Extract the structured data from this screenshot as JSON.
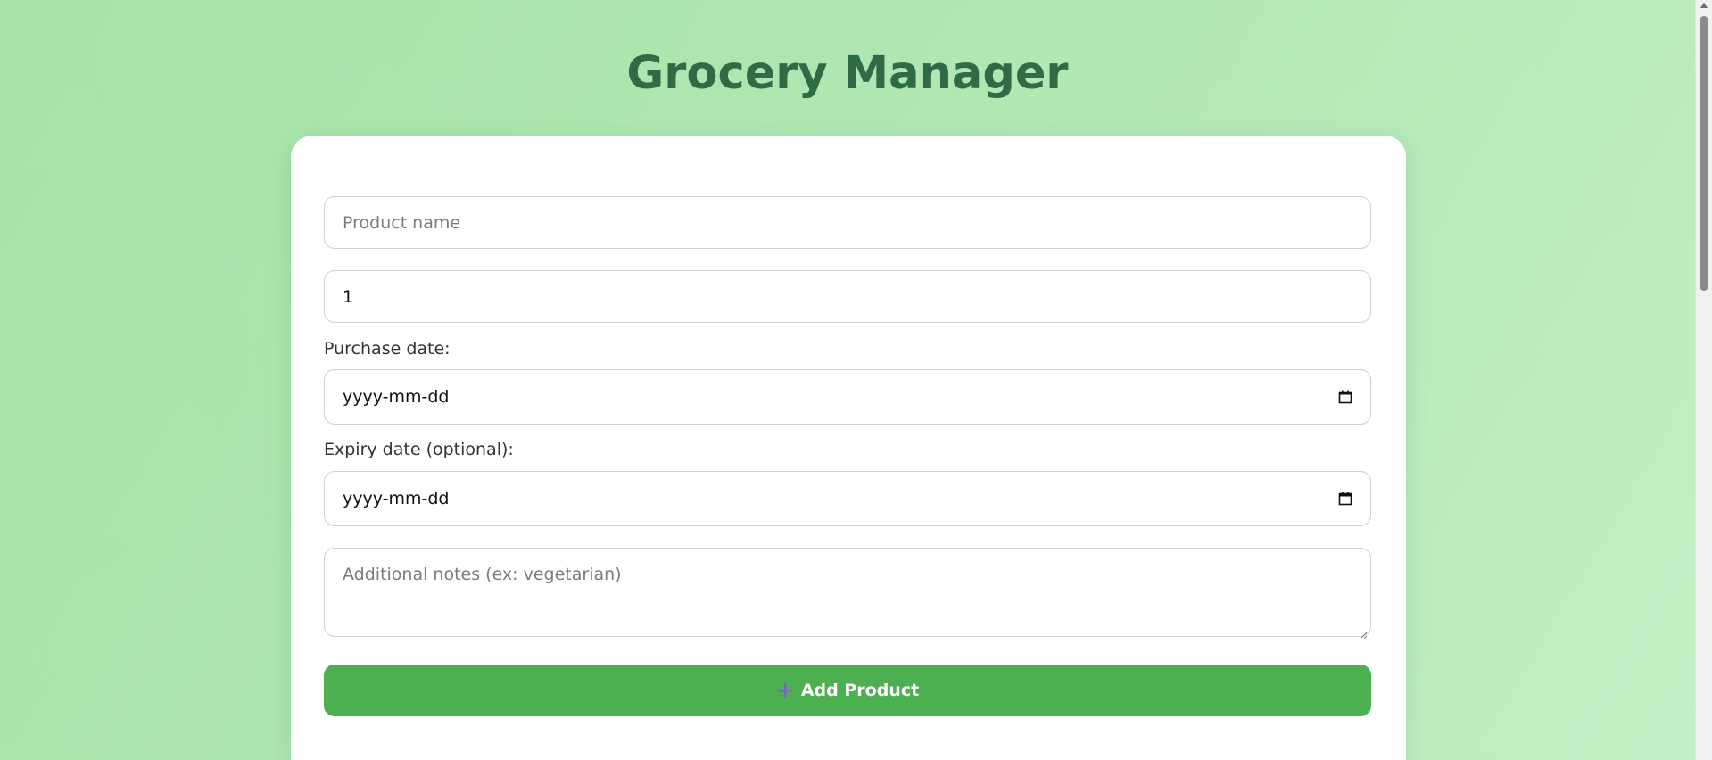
{
  "header": {
    "title": "Grocery Manager"
  },
  "form": {
    "product_name": {
      "placeholder": "Product name",
      "value": ""
    },
    "quantity": {
      "value": "1"
    },
    "purchase_date": {
      "label": "Purchase date:",
      "value": "yyyy-mm-dd"
    },
    "expiry_date": {
      "label": "Expiry date (optional):",
      "value": "yyyy-mm-dd"
    },
    "notes": {
      "placeholder": "Additional notes (ex: vegetarian)",
      "value": ""
    },
    "submit": {
      "label": "Add Product",
      "icon": "plus-icon"
    }
  },
  "colors": {
    "background": "#a5e3a7",
    "title": "#2f6b45",
    "button": "#4caf50",
    "plus_icon": "#7b61c9"
  }
}
